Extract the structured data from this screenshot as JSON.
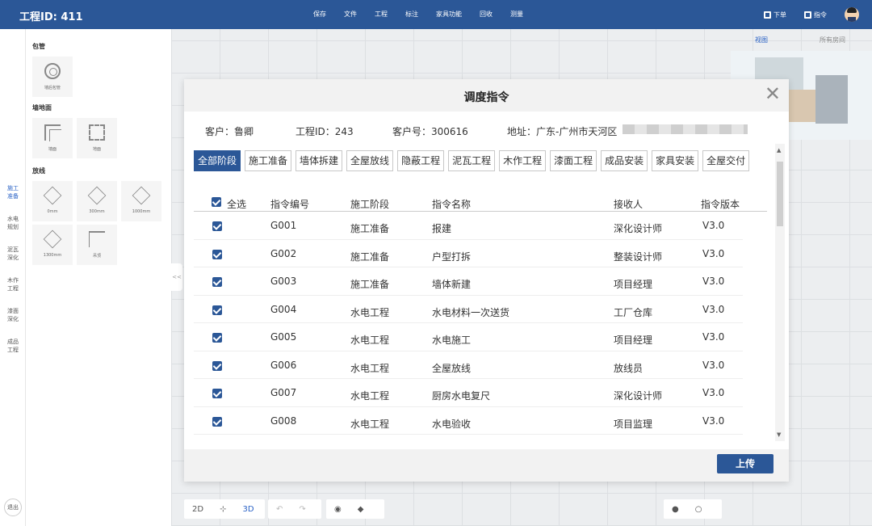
{
  "topbar": {
    "project_title": "工程ID: 411",
    "menu": [
      "保存",
      "文件",
      "工程",
      "标注",
      "家具功能",
      "回收",
      "测量"
    ],
    "order_label": "下单",
    "instruction_label": "指令"
  },
  "leftnav": {
    "items": [
      "施工\n准备",
      "水电\n规划",
      "泥瓦\n深化",
      "木作\n工程",
      "漆面\n深化",
      "成品\n工程"
    ],
    "active_index": 0,
    "exit_label": "退出"
  },
  "panel": {
    "sections": [
      {
        "title": "包管",
        "items": [
          "墙后包管"
        ]
      },
      {
        "title": "墙地面",
        "items": [
          "墙面",
          "地面"
        ]
      },
      {
        "title": "放线",
        "items": [
          "0mm",
          "300mm",
          "1000mm",
          "1300mm",
          "吊顶"
        ]
      }
    ],
    "collapse_label": "<<"
  },
  "view_tabs": {
    "view": "视图",
    "all_rooms": "所有房间"
  },
  "modal": {
    "title": "调度指令",
    "customer": "客户：鲁卿",
    "project_id": "工程ID：243",
    "customer_no": "客户号：300616",
    "address": "地址：广东-广州市天河区",
    "stages": [
      "全部阶段",
      "施工准备",
      "墙体拆建",
      "全屋放线",
      "隐蔽工程",
      "泥瓦工程",
      "木作工程",
      "漆面工程",
      "成品安装",
      "家具安装",
      "全屋交付"
    ],
    "active_stage": 0,
    "columns": {
      "select_all": "全选",
      "code": "指令编号",
      "stage": "施工阶段",
      "name": "指令名称",
      "receiver": "接收人",
      "version": "指令版本"
    },
    "rows": [
      {
        "code": "G001",
        "stage": "施工准备",
        "name": "报建",
        "receiver": "深化设计师",
        "version": "V3.0",
        "checked": true
      },
      {
        "code": "G002",
        "stage": "施工准备",
        "name": "户型打拆",
        "receiver": "整装设计师",
        "version": "V3.0",
        "checked": true
      },
      {
        "code": "G003",
        "stage": "施工准备",
        "name": "墙体新建",
        "receiver": "项目经理",
        "version": "V3.0",
        "checked": true
      },
      {
        "code": "G004",
        "stage": "水电工程",
        "name": "水电材料一次送货",
        "receiver": "工厂仓库",
        "version": "V3.0",
        "checked": true
      },
      {
        "code": "G005",
        "stage": "水电工程",
        "name": "水电施工",
        "receiver": "项目经理",
        "version": "V3.0",
        "checked": true
      },
      {
        "code": "G006",
        "stage": "水电工程",
        "name": "全屋放线",
        "receiver": "放线员",
        "version": "V3.0",
        "checked": true
      },
      {
        "code": "G007",
        "stage": "水电工程",
        "name": "厨房水电复尺",
        "receiver": "深化设计师",
        "version": "V3.0",
        "checked": true
      },
      {
        "code": "G008",
        "stage": "水电工程",
        "name": "水电验收",
        "receiver": "项目监理",
        "version": "V3.0",
        "checked": true
      }
    ],
    "upload_label": "上传"
  },
  "bottom_toolbar": {
    "view_2d": "2D",
    "view_3d": "3D"
  },
  "colors": {
    "primary": "#2b5797",
    "accent_text": "#2b63c6"
  }
}
